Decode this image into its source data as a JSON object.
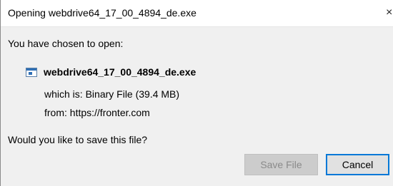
{
  "window": {
    "title": "Opening webdrive64_17_00_4894_de.exe",
    "close_glyph": "×"
  },
  "dialog": {
    "chosen_label": "You have chosen to open:",
    "file_icon": "exe-file-icon",
    "file_name": "webdrive64_17_00_4894_de.exe",
    "which_is_label": "which is:",
    "which_is_value": "Binary File (39.4 MB)",
    "from_label": "from:",
    "from_value": "https://fronter.com",
    "question": "Would you like to save this file?"
  },
  "buttons": {
    "save_label": "Save File",
    "cancel_label": "Cancel"
  },
  "colors": {
    "focus_border": "#0078d7",
    "disabled_text": "#8a8a8a",
    "body_background": "#f0f0f0"
  }
}
